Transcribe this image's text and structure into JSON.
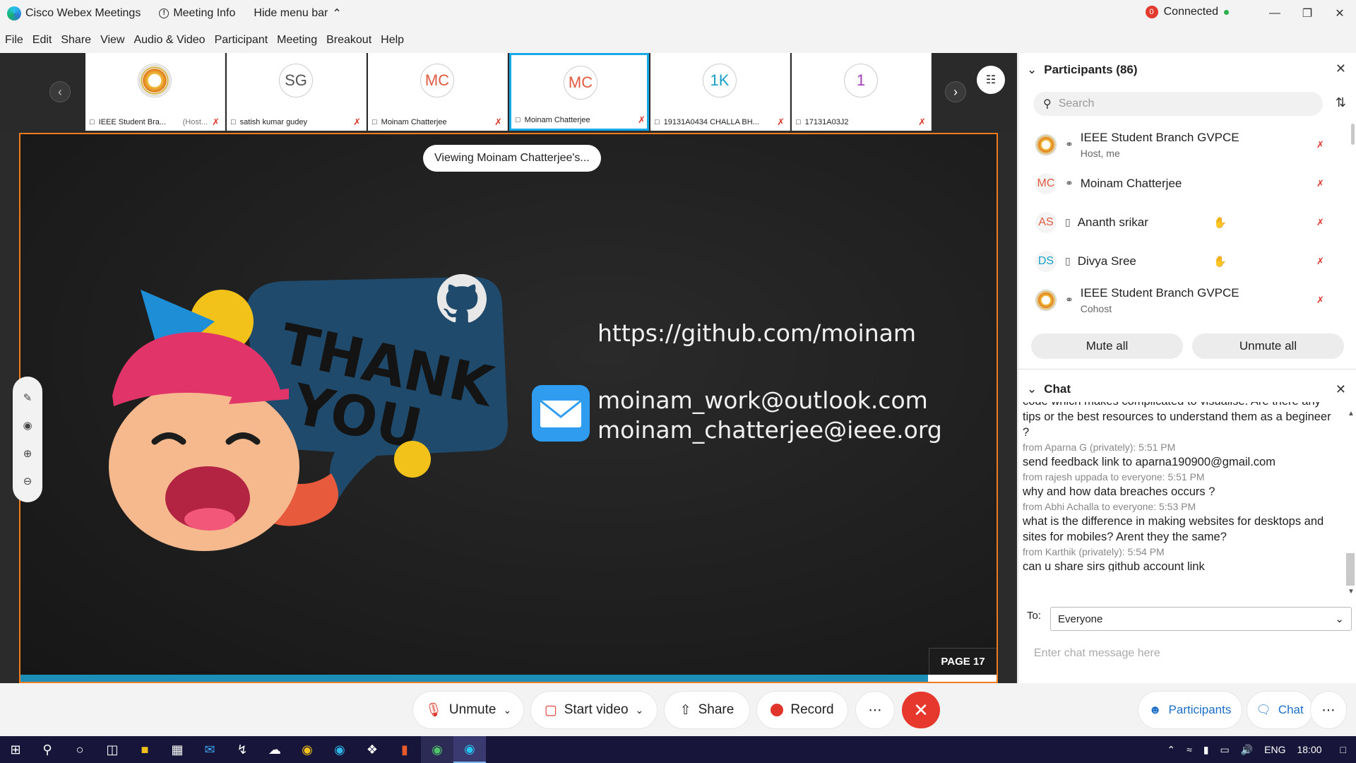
{
  "window": {
    "title": "Cisco Webex Meetings",
    "meeting_info": "Meeting Info",
    "hide_menu": "Hide menu bar",
    "status_badge": "0",
    "status": "Connected"
  },
  "menu": [
    "File",
    "Edit",
    "Share",
    "View",
    "Audio & Video",
    "Participant",
    "Meeting",
    "Breakout",
    "Help"
  ],
  "filmstrip": [
    {
      "initials": "",
      "name": "IEEE Student Bra...",
      "suffix": "(Host...",
      "avatar_color": "#d07a1a",
      "seal": true
    },
    {
      "initials": "SG",
      "name": "satish kumar gudey",
      "avatar_color": "#555555"
    },
    {
      "initials": "MC",
      "name": "Moinam Chatterjee",
      "avatar_color": "#e05a40"
    },
    {
      "initials": "MC",
      "name": "Moinam Chatterjee",
      "avatar_color": "#e05a40",
      "selected": true
    },
    {
      "initials": "1K",
      "name": "19131A0434 CHALLA BH...",
      "avatar_color": "#18a0c8"
    },
    {
      "initials": "1",
      "name": "17131A03J2",
      "avatar_color": "#a03ab8"
    }
  ],
  "share": {
    "viewing": "Viewing Moinam Chatterjee's...",
    "slide": {
      "thank": "THANK",
      "you": "YOU",
      "github_url": "https://github.com/moinam",
      "email1": "moinam_work@outlook.com",
      "email2": "moinam_chatterjee@ieee.org",
      "page": "PAGE 17",
      "progress_fraction": 0.93
    }
  },
  "participants": {
    "title": "Participants (86)",
    "search_placeholder": "Search",
    "list": [
      {
        "initials": "",
        "name": "IEEE Student Branch GVPCE",
        "sub": "Host, me",
        "seal": true,
        "device": "headset"
      },
      {
        "initials": "MC",
        "name": "Moinam Chatterjee",
        "sub": "",
        "color": "#e05a40",
        "device": "headset"
      },
      {
        "initials": "AS",
        "name": "Ananth srikar",
        "sub": "",
        "color": "#e05a40",
        "device": "phone",
        "hand": true
      },
      {
        "initials": "DS",
        "name": "Divya Sree",
        "sub": "",
        "color": "#18a0c8",
        "device": "phone",
        "hand": true
      },
      {
        "initials": "",
        "name": "IEEE Student Branch GVPCE",
        "sub": "Cohost",
        "seal": true,
        "device": "headset"
      }
    ],
    "mute_all": "Mute all",
    "unmute_all": "Unmute all"
  },
  "chat": {
    "title": "Chat",
    "messages": [
      {
        "from": "",
        "text": "code which makes complicated to visualise. Are there any tips  or the best resources to understand them as a begineer  ?"
      },
      {
        "from": "from Aparna G (privately):    5:51 PM",
        "text": "send feedback link to aparna190900@gmail.com"
      },
      {
        "from": "from rajesh uppada to everyone:    5:51 PM",
        "text": "why and how data breaches occurs ?"
      },
      {
        "from": "from Abhi Achalla to everyone:    5:53 PM",
        "text": "what is the difference in making websites for desktops and sites for mobiles? Arent they the same?"
      },
      {
        "from": "from Karthik (privately):    5:54 PM",
        "text": "can u share sirs github account link"
      }
    ],
    "to_label": "To:",
    "to_value": "Everyone",
    "input_placeholder": "Enter chat message here"
  },
  "controls": {
    "unmute": "Unmute",
    "start_video": "Start video",
    "share": "Share",
    "record": "Record",
    "more": "⋯",
    "participants": "Participants",
    "chat": "Chat"
  },
  "taskbar": {
    "lang": "ENG",
    "time": "18:00"
  }
}
